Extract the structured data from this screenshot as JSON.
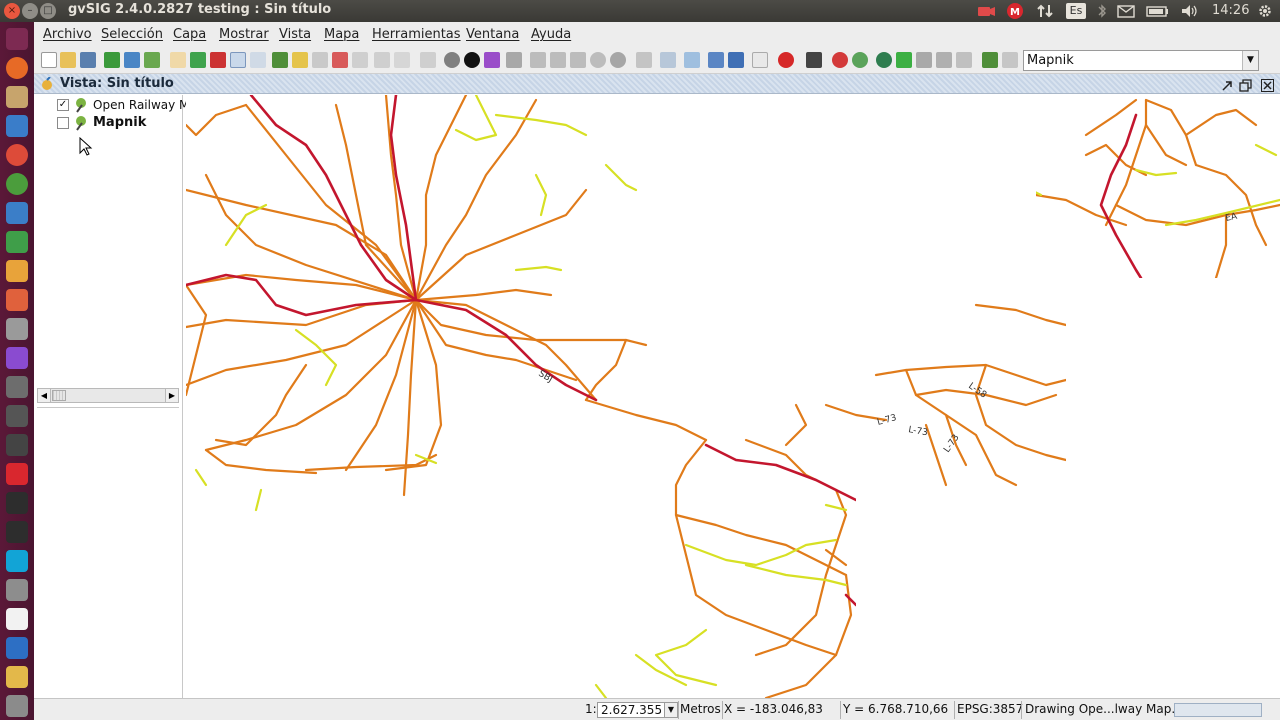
{
  "window": {
    "title": "gvSIG 2.4.0.2827 testing : Sin título",
    "close_glyph": "×",
    "min_glyph": "–",
    "max_glyph": "□"
  },
  "tray": {
    "keyboard": "Es",
    "clock": "14:26"
  },
  "menu": [
    "Archivo",
    "Selección",
    "Capa",
    "Mostrar",
    "Vista",
    "Mapa",
    "Herramientas",
    "Ventana",
    "Ayuda"
  ],
  "toolbar": {
    "renderer_selected": "Mapnik",
    "dropdown_glyph": "▼"
  },
  "view": {
    "title": "Vista: Sin título"
  },
  "toc": {
    "layers": [
      {
        "label": "Open Railway M",
        "checked": true,
        "bold": false
      },
      {
        "label": "Mapnik",
        "checked": false,
        "bold": true
      }
    ],
    "check_glyph": "✓"
  },
  "map": {
    "labels": [
      "SBJ",
      "L-73",
      "L-73",
      "L-58",
      "L-73",
      "EA"
    ]
  },
  "status": {
    "scale_prefix": "1:",
    "scale_value": "2.627.355",
    "units": "Metros",
    "x_coord": "X = -183.046,83",
    "y_coord": "Y = 6.768.710,66",
    "crs": "EPSG:3857",
    "task": "Drawing Ope...lway Map..."
  },
  "colors": {
    "main_line": "#e07b1a",
    "high_speed": "#c3162e",
    "branch": "#d7e024",
    "launcher": "#5b1838"
  }
}
